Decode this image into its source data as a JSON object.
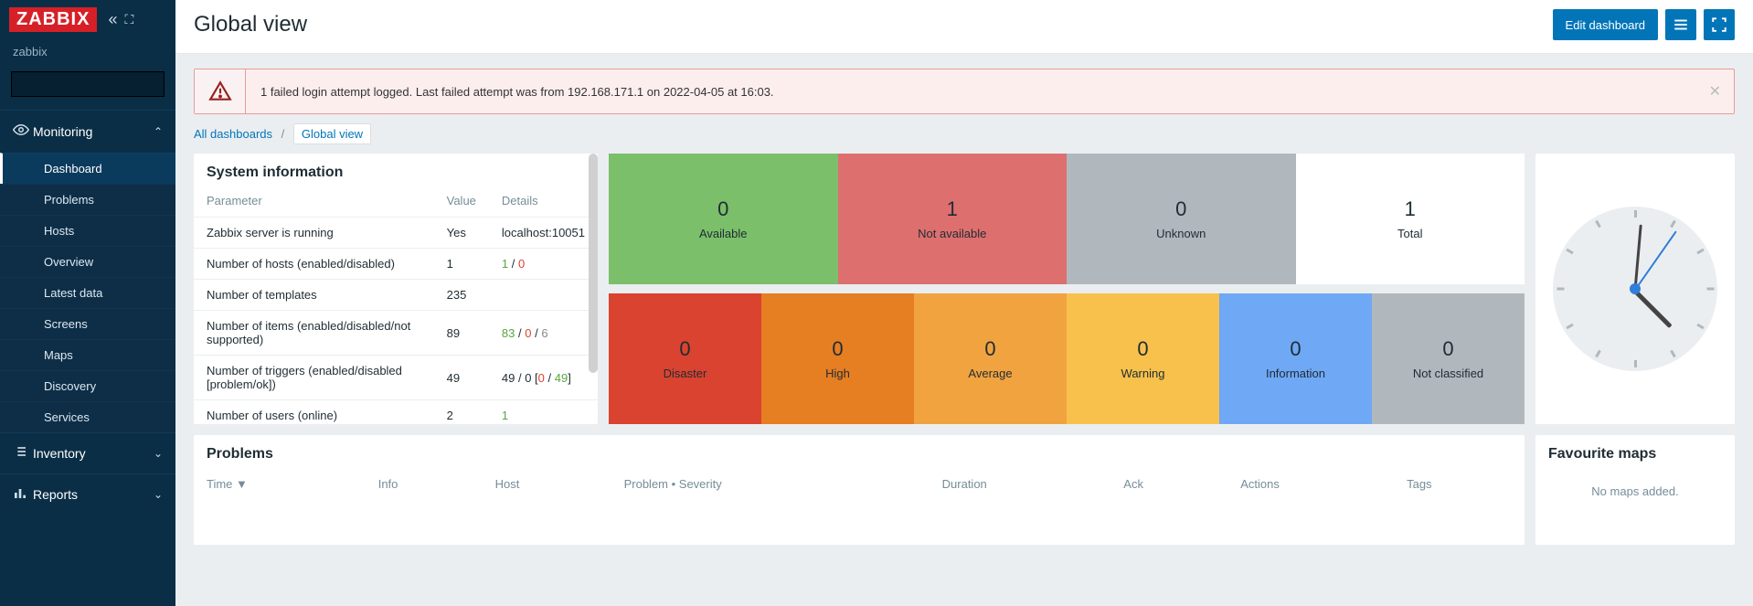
{
  "brand": "ZABBIX",
  "server_name": "zabbix",
  "search": {
    "placeholder": ""
  },
  "nav": {
    "monitoring": {
      "label": "Monitoring",
      "items": [
        {
          "label": "Dashboard",
          "active": true
        },
        {
          "label": "Problems"
        },
        {
          "label": "Hosts"
        },
        {
          "label": "Overview"
        },
        {
          "label": "Latest data"
        },
        {
          "label": "Screens"
        },
        {
          "label": "Maps"
        },
        {
          "label": "Discovery"
        },
        {
          "label": "Services"
        }
      ]
    },
    "inventory": {
      "label": "Inventory"
    },
    "reports": {
      "label": "Reports"
    }
  },
  "page_title": "Global view",
  "actions": {
    "edit": "Edit dashboard"
  },
  "alert": {
    "message": "1 failed login attempt logged. Last failed attempt was from 192.168.171.1 on 2022-04-05 at 16:03."
  },
  "breadcrumb": {
    "root": "All dashboards",
    "current": "Global view"
  },
  "sysinfo": {
    "title": "System information",
    "headers": {
      "param": "Parameter",
      "value": "Value",
      "details": "Details"
    },
    "rows": [
      {
        "param": "Zabbix server is running",
        "value": "Yes",
        "value_cls": "val-green",
        "details_html": "localhost:10051"
      },
      {
        "param": "Number of hosts (enabled/disabled)",
        "value": "1",
        "details_html": "<span class='val-green'>1</span> / <span class='val-red'>0</span>"
      },
      {
        "param": "Number of templates",
        "value": "235",
        "details_html": ""
      },
      {
        "param": "Number of items (enabled/disabled/not supported)",
        "value": "89",
        "details_html": "<span class='val-green'>83</span> / <span class='val-red'>0</span> / <span class='val-grey'>6</span>"
      },
      {
        "param": "Number of triggers (enabled/disabled [problem/ok])",
        "value": "49",
        "details_html": "49 / 0 [<span class='val-red'>0</span> / <span class='val-green'>49</span>]"
      },
      {
        "param": "Number of users (online)",
        "value": "2",
        "details_html": "<span class='val-green'>1</span>"
      }
    ]
  },
  "host_status": [
    {
      "num": "0",
      "label": "Available",
      "cls": "bg-avail"
    },
    {
      "num": "1",
      "label": "Not available",
      "cls": "bg-notavail"
    },
    {
      "num": "0",
      "label": "Unknown",
      "cls": "bg-unknown"
    },
    {
      "num": "1",
      "label": "Total",
      "cls": "bg-total"
    }
  ],
  "severity_status": [
    {
      "num": "0",
      "label": "Disaster",
      "cls": "bg-disaster"
    },
    {
      "num": "0",
      "label": "High",
      "cls": "bg-high"
    },
    {
      "num": "0",
      "label": "Average",
      "cls": "bg-average"
    },
    {
      "num": "0",
      "label": "Warning",
      "cls": "bg-warning"
    },
    {
      "num": "0",
      "label": "Information",
      "cls": "bg-info"
    },
    {
      "num": "0",
      "label": "Not classified",
      "cls": "bg-notclass"
    }
  ],
  "problems": {
    "title": "Problems",
    "headers": [
      "Time ▼",
      "Info",
      "Host",
      "Problem • Severity",
      "Duration",
      "Ack",
      "Actions",
      "Tags"
    ]
  },
  "favmaps": {
    "title": "Favourite maps",
    "empty": "No maps added."
  }
}
